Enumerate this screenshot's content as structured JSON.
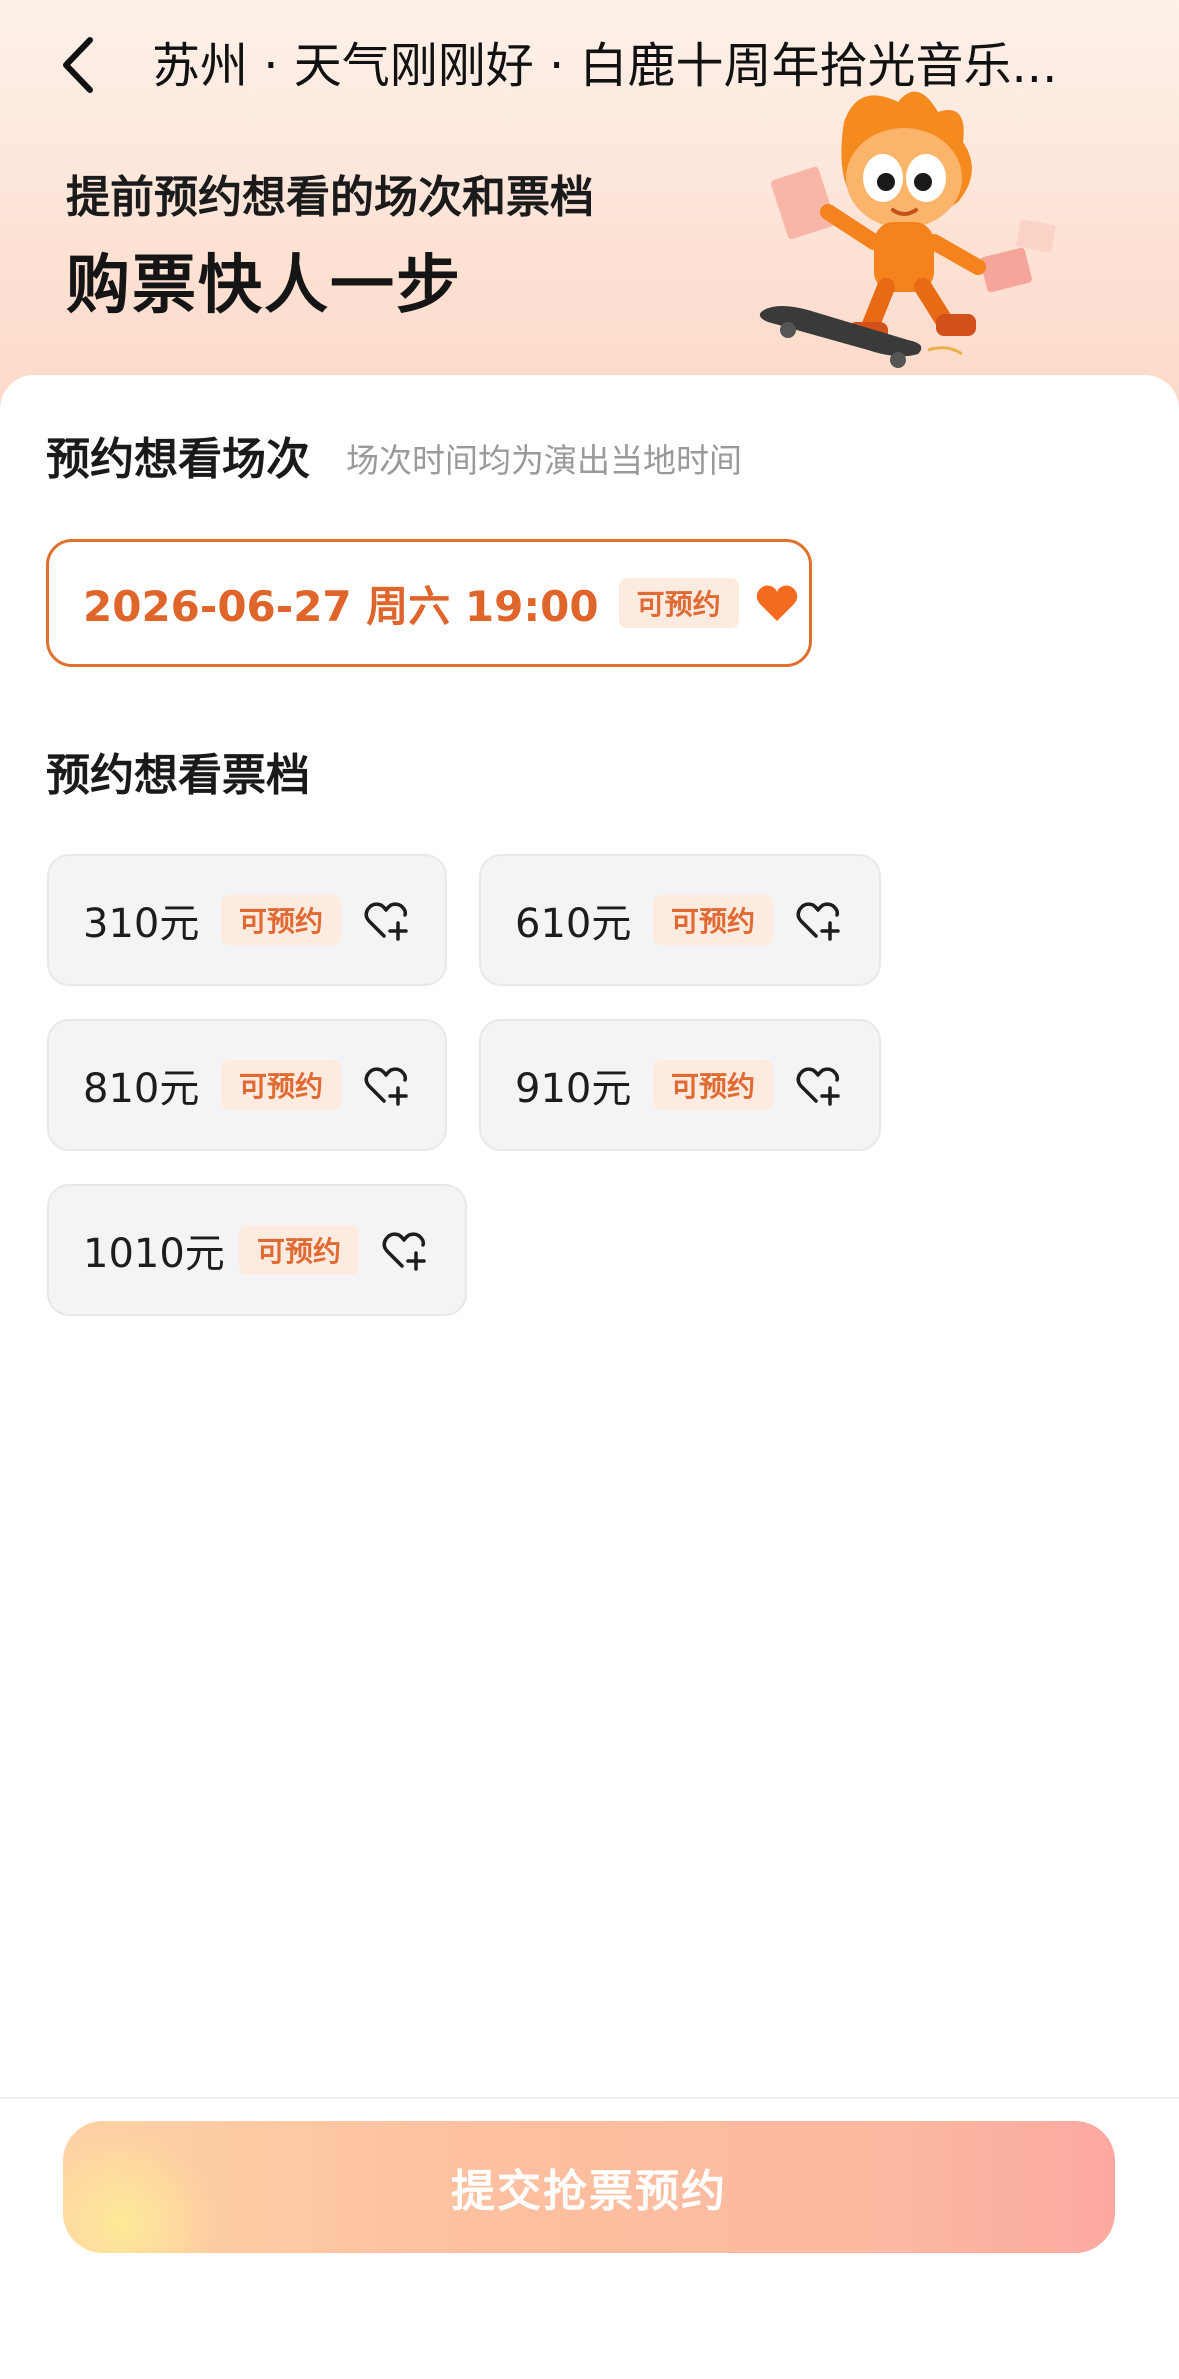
{
  "header": {
    "title": "苏州 · 天气刚刚好 · 白鹿十周年拾光音乐..."
  },
  "hero": {
    "subtitle": "提前预约想看的场次和票档",
    "headline": "购票快人一步"
  },
  "sessions": {
    "title": "预约想看场次",
    "hint": "场次时间均为演出当地时间",
    "items": [
      {
        "label": "2026-06-27  周六 19:00",
        "status": "可预约",
        "selected": true
      }
    ]
  },
  "tiers": {
    "title": "预约想看票档",
    "items": [
      {
        "price": "310元",
        "status": "可预约"
      },
      {
        "price": "610元",
        "status": "可预约"
      },
      {
        "price": "810元",
        "status": "可预约"
      },
      {
        "price": "910元",
        "status": "可预约"
      },
      {
        "price": "1010元",
        "status": "可预约"
      }
    ]
  },
  "footer": {
    "submit_label": "提交抢票预约"
  },
  "colors": {
    "accent": "#e0652a",
    "badge_bg": "#fdebe0",
    "tier_bg": "#f4f4f6",
    "submit_gradient_start": "#fdd2a4",
    "submit_gradient_end": "#fca8a0"
  },
  "icons": {
    "back": "chevron-left-icon",
    "session_heart": "heart-filled-icon",
    "tier_heart": "heart-add-icon"
  }
}
